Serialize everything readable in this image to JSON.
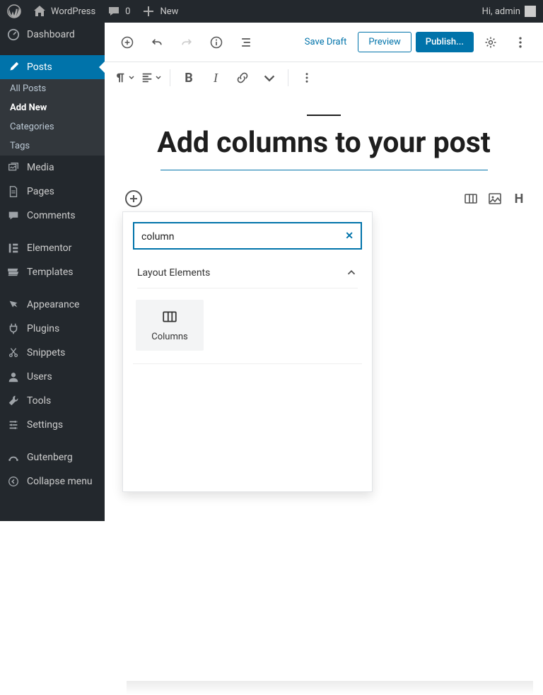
{
  "adminbar": {
    "site_name": "WordPress",
    "comments_count": "0",
    "new_label": "New",
    "greeting": "Hi, admin"
  },
  "sidebar": {
    "dashboard": "Dashboard",
    "posts": "Posts",
    "posts_sub": {
      "all": "All Posts",
      "add": "Add New",
      "categories": "Categories",
      "tags": "Tags"
    },
    "media": "Media",
    "pages": "Pages",
    "comments": "Comments",
    "elementor": "Elementor",
    "templates": "Templates",
    "appearance": "Appearance",
    "plugins": "Plugins",
    "snippets": "Snippets",
    "users": "Users",
    "tools": "Tools",
    "settings": "Settings",
    "gutenberg": "Gutenberg",
    "collapse": "Collapse menu"
  },
  "topbar": {
    "save_draft": "Save Draft",
    "preview": "Preview",
    "publish": "Publish..."
  },
  "post": {
    "title": "Add columns to your post"
  },
  "inserter": {
    "search_value": "column",
    "section_label": "Layout Elements",
    "block_columns_label": "Columns"
  }
}
